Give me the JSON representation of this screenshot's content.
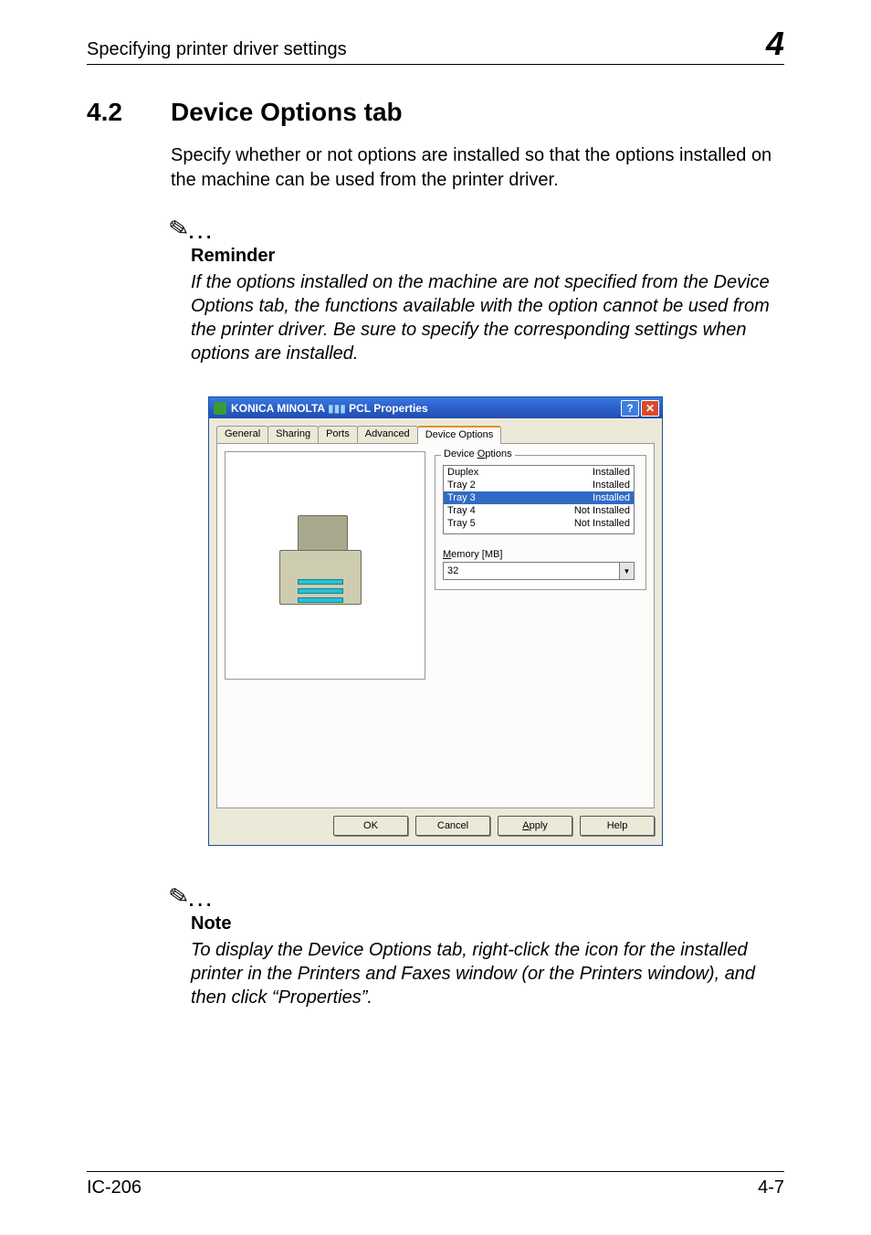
{
  "header": {
    "running": "Specifying printer driver settings",
    "chapter_num": "4"
  },
  "section": {
    "num": "4.2",
    "title": "Device Options tab",
    "intro": "Specify whether or not options are installed so that the options installed on the machine can be used from the printer driver."
  },
  "reminder": {
    "heading": "Reminder",
    "body": "If the options installed on the machine are not specified from the Device Options tab, the functions available with the option cannot be used from the printer driver. Be sure to specify the corresponding settings when options are installed."
  },
  "dialog": {
    "title_prefix": "KONICA MINOLTA",
    "title_suffix": " PCL Properties",
    "tabs": [
      "General",
      "Sharing",
      "Ports",
      "Advanced",
      "Device Options"
    ],
    "active_tab": "Device Options",
    "group_label_1": "Device ",
    "group_label_2": "O",
    "group_label_3": "ptions",
    "options": [
      {
        "name": "Duplex",
        "status": "Installed",
        "selected": false
      },
      {
        "name": "Tray 2",
        "status": "Installed",
        "selected": false
      },
      {
        "name": "Tray 3",
        "status": "Installed",
        "selected": true
      },
      {
        "name": "Tray 4",
        "status": "Not Installed",
        "selected": false
      },
      {
        "name": "Tray 5",
        "status": "Not Installed",
        "selected": false
      }
    ],
    "memory_label_1": "M",
    "memory_label_2": "emory [MB]",
    "memory_value": "32",
    "buttons": {
      "ok": "OK",
      "cancel": "Cancel",
      "apply_1": "A",
      "apply_2": "pply",
      "help": "Help"
    }
  },
  "note": {
    "heading": "Note",
    "body": "To display the Device Options tab, right-click the icon for the installed printer in the Printers and Faxes window (or the Printers window), and then click “Properties”."
  },
  "footer": {
    "left": "IC-206",
    "right": "4-7"
  }
}
